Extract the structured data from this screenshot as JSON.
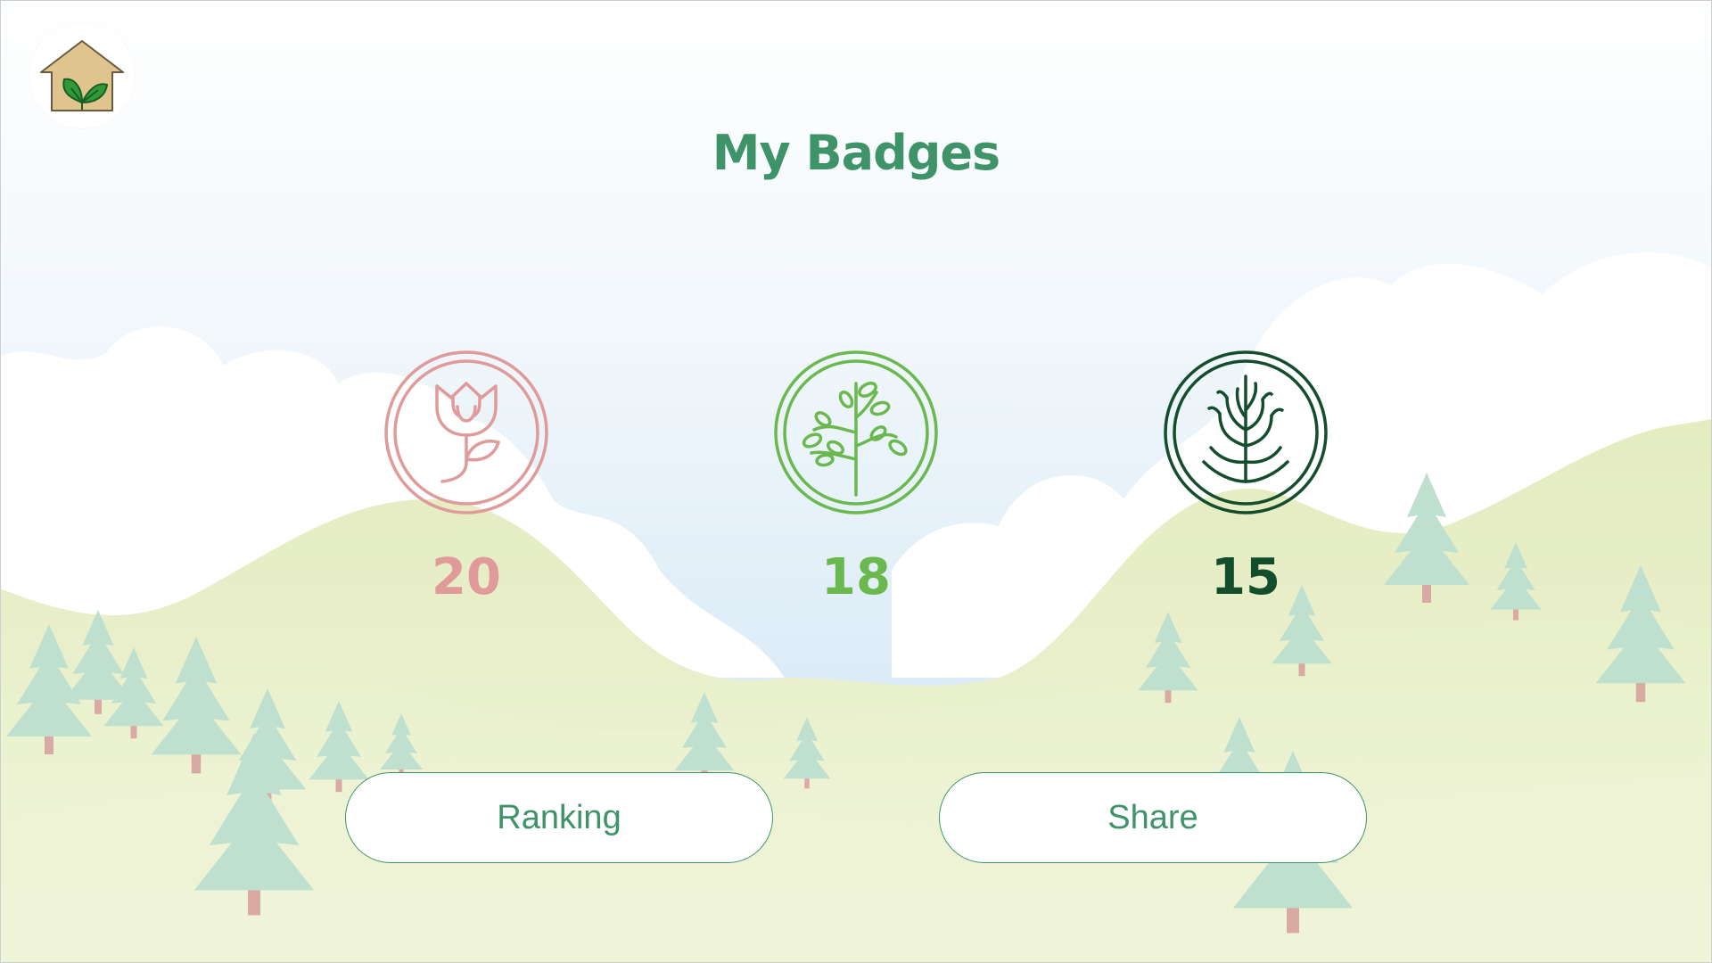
{
  "header": {
    "title": "My Badges",
    "home_icon": "house-leaf-icon"
  },
  "badges": [
    {
      "icon": "flower-badge-icon",
      "count": "20",
      "color": "#e09a9a"
    },
    {
      "icon": "sapling-badge-icon",
      "count": "18",
      "color": "#6ab84e"
    },
    {
      "icon": "tree-badge-icon",
      "count": "15",
      "color": "#134d2c"
    }
  ],
  "actions": {
    "ranking_label": "Ranking",
    "share_label": "Share"
  },
  "colors": {
    "accent": "#3e9468",
    "sky_top": "#ffffff",
    "sky_bottom": "#dcecf7",
    "hills": "#e7efc6"
  }
}
